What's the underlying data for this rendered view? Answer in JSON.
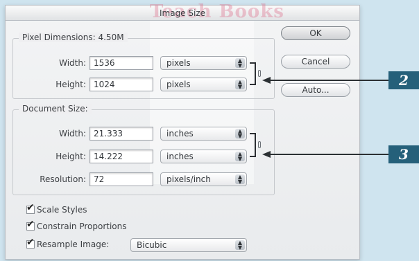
{
  "dialog": {
    "title": "Image Size",
    "watermark": "Teach Books"
  },
  "pixel_dimensions": {
    "legend": "Pixel Dimensions:",
    "size_value": "4.50M",
    "width_label": "Width:",
    "width_value": "1536",
    "width_unit": "pixels",
    "height_label": "Height:",
    "height_value": "1024",
    "height_unit": "pixels"
  },
  "document_size": {
    "legend": "Document Size:",
    "width_label": "Width:",
    "width_value": "21.333",
    "width_unit": "inches",
    "height_label": "Height:",
    "height_value": "14.222",
    "height_unit": "inches",
    "resolution_label": "Resolution:",
    "resolution_value": "72",
    "resolution_unit": "pixels/inch"
  },
  "buttons": {
    "ok": "OK",
    "cancel": "Cancel",
    "auto": "Auto..."
  },
  "options": {
    "scale_styles": "Scale Styles",
    "scale_styles_checked": true,
    "constrain_proportions": "Constrain Proportions",
    "constrain_proportions_checked": true,
    "resample_image": "Resample Image:",
    "resample_image_checked": true,
    "resample_method": "Bicubic"
  },
  "callouts": [
    "2",
    "3"
  ],
  "colors": {
    "background": "#cfe4ef",
    "callout_badge": "#25607a"
  }
}
